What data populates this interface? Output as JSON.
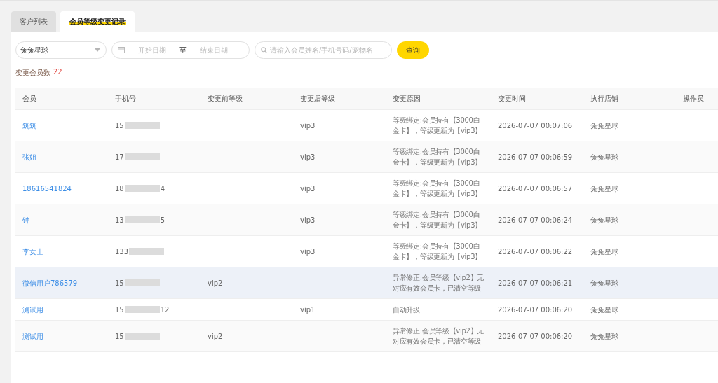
{
  "tabs": [
    {
      "label": "客户列表",
      "selected": false
    },
    {
      "label": "会员等级变更记录",
      "selected": true
    }
  ],
  "filters": {
    "store": "兔兔星球",
    "start_date_placeholder": "开始日期",
    "date_separator": "至",
    "end_date_placeholder": "结束日期",
    "search_placeholder": "请输入会员姓名/手机号码/宠物名",
    "query_button": "查询"
  },
  "summary": {
    "label": "变更会员数",
    "count": "22"
  },
  "table": {
    "columns": [
      "会员",
      "手机号",
      "变更前等级",
      "变更后等级",
      "变更原因",
      "变更时间",
      "执行店铺",
      "操作员"
    ],
    "rows": [
      {
        "member": "筑筑",
        "phone_prefix": "15",
        "phone_suffix": "",
        "before": "",
        "after": "vip3",
        "reason": "等级绑定:会员持有【3000白金卡】，等级更新为【vip3】",
        "time": "2026-07-07 00:07:06",
        "store": "兔兔星球",
        "highlighted": false
      },
      {
        "member": "张姐",
        "phone_prefix": "17",
        "phone_suffix": "",
        "before": "",
        "after": "vip3",
        "reason": "等级绑定:会员持有【3000白金卡】，等级更新为【vip3】",
        "time": "2026-07-07 00:06:59",
        "store": "兔兔星球",
        "highlighted": false
      },
      {
        "member": "18616541824",
        "phone_prefix": "18",
        "phone_suffix": "4",
        "before": "",
        "after": "vip3",
        "reason": "等级绑定:会员持有【3000白金卡】，等级更新为【vip3】",
        "time": "2026-07-07 00:06:57",
        "store": "兔兔星球",
        "highlighted": false
      },
      {
        "member": "钟",
        "phone_prefix": "13",
        "phone_suffix": "5",
        "before": "",
        "after": "vip3",
        "reason": "等级绑定:会员持有【3000白金卡】，等级更新为【vip3】",
        "time": "2026-07-07 00:06:24",
        "store": "兔兔星球",
        "highlighted": false
      },
      {
        "member": "李女士",
        "phone_prefix": "133",
        "phone_suffix": "",
        "before": "",
        "after": "vip3",
        "reason": "等级绑定:会员持有【3000白金卡】，等级更新为【vip3】",
        "time": "2026-07-07 00:06:22",
        "store": "兔兔星球",
        "highlighted": false
      },
      {
        "member": "微信用户786579",
        "phone_prefix": "15",
        "phone_suffix": "",
        "before": "vip2",
        "after": "",
        "reason": "异常修正:会员等级【vip2】无对应有效会员卡，已清空等级",
        "time": "2026-07-07 00:06:21",
        "store": "兔兔星球",
        "highlighted": true
      },
      {
        "member": "测试用",
        "phone_prefix": "15",
        "phone_suffix": "12",
        "before": "",
        "after": "vip1",
        "reason": "自动升级",
        "time": "2026-07-07 00:06:20",
        "store": "兔兔星球",
        "highlighted": false
      },
      {
        "member": "测试用",
        "phone_prefix": "15",
        "phone_suffix": "",
        "before": "vip2",
        "after": "",
        "reason": "异常修正:会员等级【vip2】无对应有效会员卡，已清空等级",
        "time": "2026-07-07 00:06:20",
        "store": "兔兔星球",
        "highlighted": false
      }
    ]
  }
}
